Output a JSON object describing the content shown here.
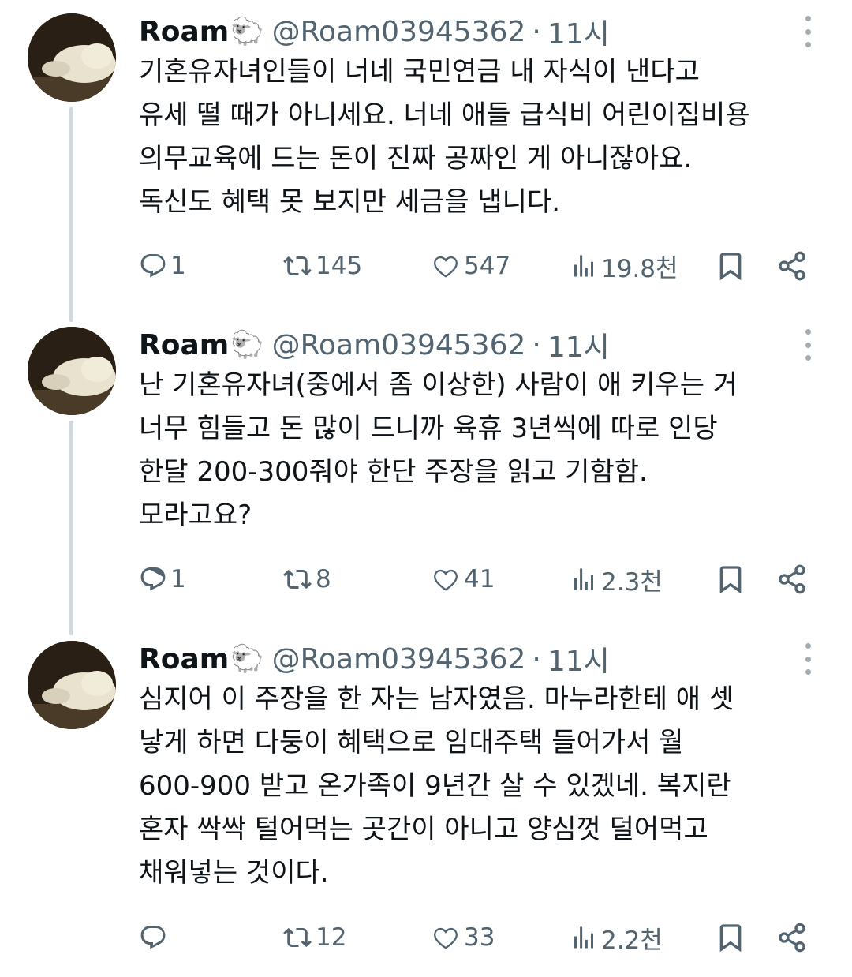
{
  "tweets": [
    {
      "name": "Roam",
      "emoji": "🐑",
      "handle": "@Roam03945362",
      "separator": "·",
      "time": "11시",
      "lines": [
        "기혼유자녀인들이 너네 국민연금 내 자식이 낸다고",
        "유세 떨 때가 아니세요. 너네 애들 급식비 어린이집비용",
        "의무교육에 드는 돈이 진짜 공짜인 게 아니잖아요.",
        "독신도 혜택 못 보지만 세금을 냅니다."
      ],
      "replies": "1",
      "retweets": "145",
      "likes": "547",
      "views": "19.8천"
    },
    {
      "name": "Roam",
      "emoji": "🐑",
      "handle": "@Roam03945362",
      "separator": "·",
      "time": "11시",
      "lines": [
        "난 기혼유자녀(중에서 좀 이상한) 사람이 애 키우는 거",
        "너무 힘들고 돈 많이 드니까 육휴 3년씩에 따로 인당",
        "한달 200-300줘야 한단 주장을 읽고 기함함.",
        "모라고요?"
      ],
      "replies": "1",
      "retweets": "8",
      "likes": "41",
      "views": "2.3천"
    },
    {
      "name": "Roam",
      "emoji": "🐑",
      "handle": "@Roam03945362",
      "separator": "·",
      "time": "11시",
      "lines": [
        "심지어 이 주장을 한 자는 남자였음. 마누라한테 애 셋",
        "낳게 하면 다둥이 혜택으로 임대주택 들어가서 월",
        "600-900 받고 온가족이 9년간 살 수 있겠네. 복지란",
        "혼자 싹싹 털어먹는 곳간이 아니고 양심껏 덜어먹고",
        "채워넣는 것이다."
      ],
      "replies": "",
      "retweets": "12",
      "likes": "33",
      "views": "2.2천"
    }
  ],
  "icons": {
    "reply": "reply-icon",
    "retweet": "retweet-icon",
    "like": "heart-icon",
    "views": "views-icon",
    "bookmark": "bookmark-icon",
    "share": "share-icon",
    "more": "more-icon"
  },
  "colors": {
    "text": "#0f1419",
    "secondary": "#536471",
    "thread_line": "#cfd9de"
  }
}
